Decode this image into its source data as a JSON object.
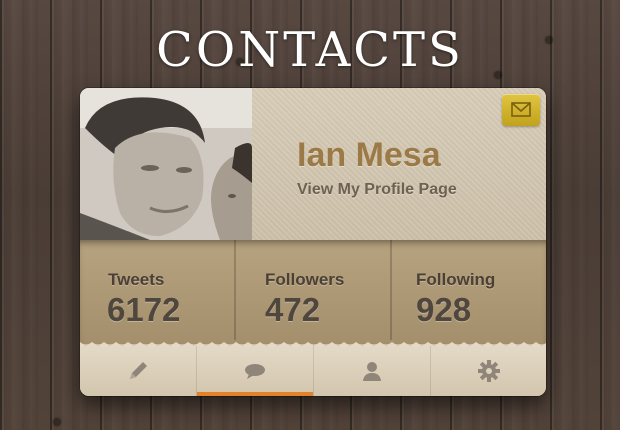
{
  "header": {
    "title": "CONTACTS"
  },
  "profile": {
    "name": "Ian Mesa",
    "link_label": "View My Profile Page"
  },
  "stats": [
    {
      "label": "Tweets",
      "value": "6172"
    },
    {
      "label": "Followers",
      "value": "472"
    },
    {
      "label": "Following",
      "value": "928"
    }
  ],
  "tabs": [
    {
      "icon": "pencil-icon",
      "active": false
    },
    {
      "icon": "speech-bubble-icon",
      "active": true
    },
    {
      "icon": "user-icon",
      "active": false
    },
    {
      "icon": "gear-icon",
      "active": false
    }
  ],
  "colors": {
    "accent": "#e3822a",
    "name_color": "#9b7a47",
    "mail_button": "#d4b530",
    "background_wood": "#4f4038"
  }
}
